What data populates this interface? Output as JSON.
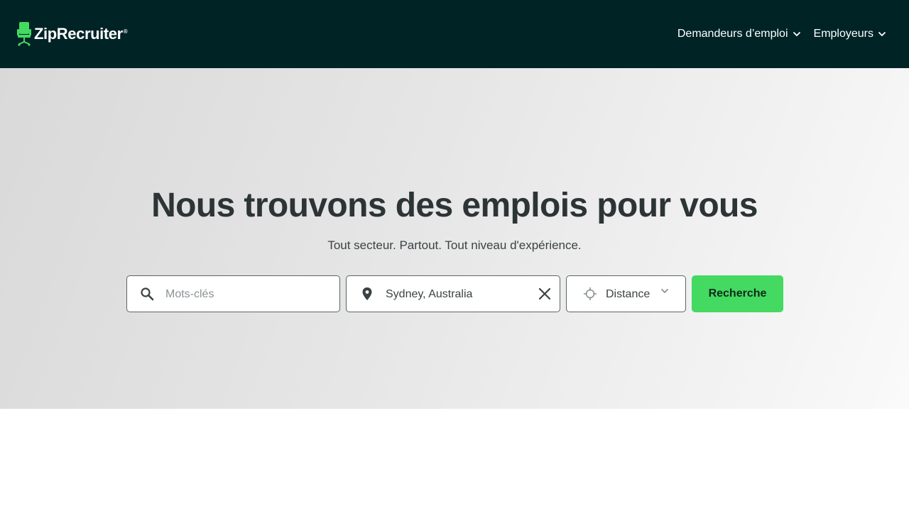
{
  "brand": {
    "name": "ZipRecruiter",
    "registered_mark": "®",
    "logo_icon": "chair-icon",
    "logo_color": "#44d961"
  },
  "nav": {
    "items": [
      {
        "label": "Demandeurs d’emploi",
        "icon": "chevron-down-icon"
      },
      {
        "label": "Employeurs",
        "icon": "chevron-down-icon"
      }
    ]
  },
  "hero": {
    "title": "Nous trouvons des emplois pour vous",
    "subtitle": "Tout secteur. Partout. Tout niveau d'expérience."
  },
  "search": {
    "keywords": {
      "placeholder": "Mots-clés",
      "value": "",
      "icon": "search-icon"
    },
    "location": {
      "value": "Sydney, Australia",
      "icon": "map-pin-icon",
      "clear_icon": "close-icon"
    },
    "distance": {
      "label": "Distance",
      "icon": "crosshair-icon",
      "chevron_icon": "chevron-down-icon"
    },
    "button_label": "Recherche"
  },
  "colors": {
    "header_bg": "#002326",
    "accent_green": "#44d961",
    "text_dark": "#2d3436"
  }
}
